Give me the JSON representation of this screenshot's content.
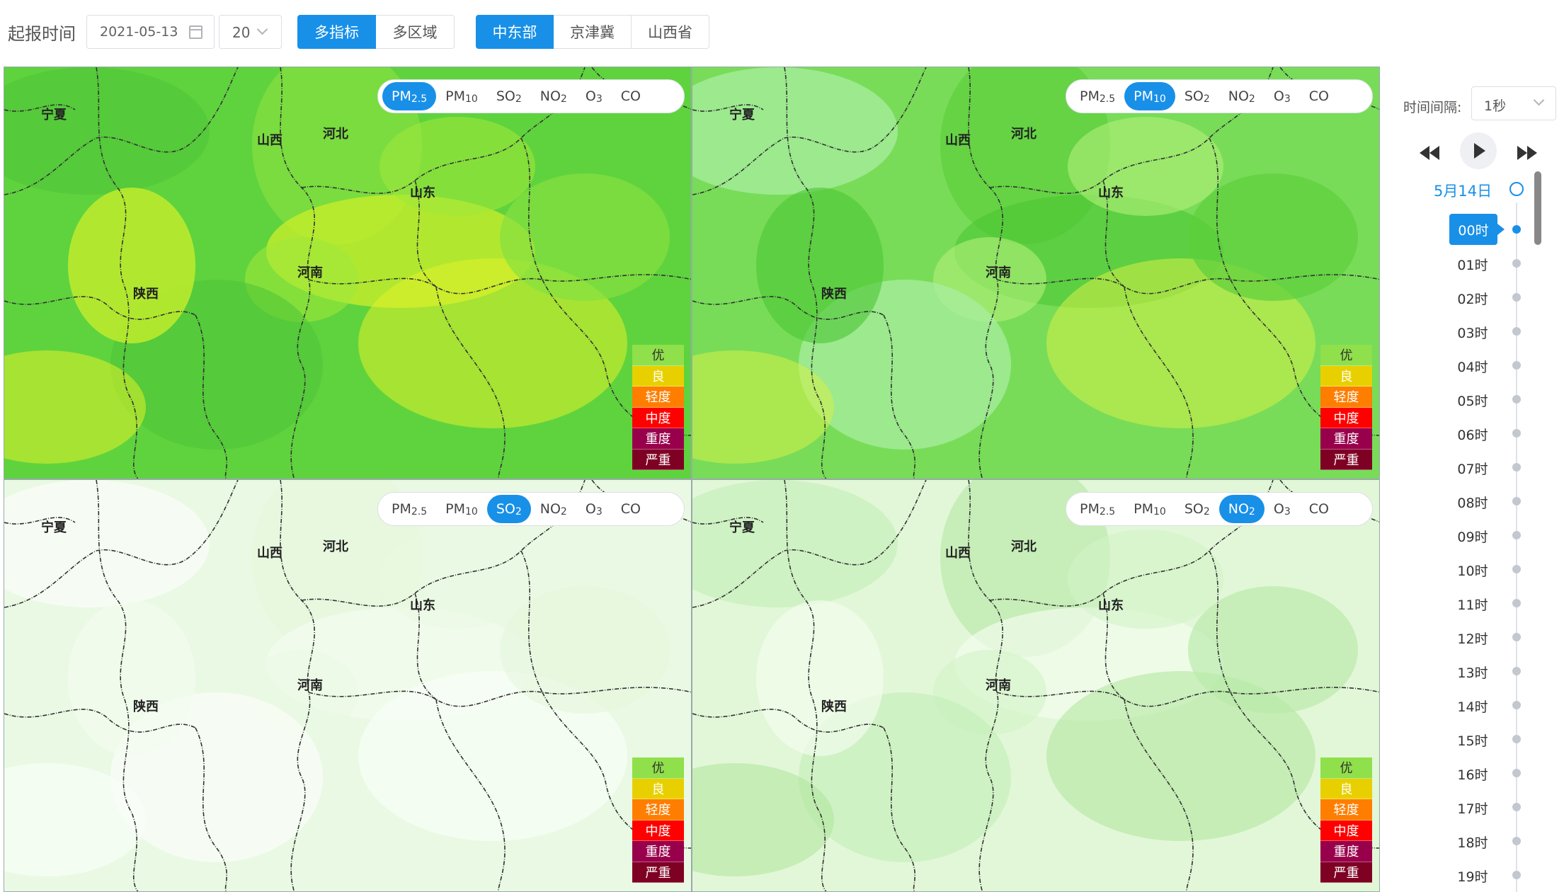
{
  "toolbar": {
    "label": "起报时间",
    "date_value": "2021-05-13",
    "hour_value": "20",
    "mode_tabs": [
      {
        "label": "多指标",
        "active": true
      },
      {
        "label": "多区域",
        "active": false
      }
    ],
    "region_tabs": [
      {
        "label": "中东部",
        "active": true
      },
      {
        "label": "京津冀",
        "active": false
      },
      {
        "label": "山西省",
        "active": false
      }
    ]
  },
  "pollutants": [
    {
      "base": "PM",
      "sub": "2.5"
    },
    {
      "base": "PM",
      "sub": "10"
    },
    {
      "base": "SO",
      "sub": "2"
    },
    {
      "base": "NO",
      "sub": "2"
    },
    {
      "base": "O",
      "sub": "3"
    },
    {
      "base": "CO",
      "sub": ""
    }
  ],
  "panels": [
    {
      "active_pollutant": 0,
      "theme": "pm25"
    },
    {
      "active_pollutant": 1,
      "theme": "pm10"
    },
    {
      "active_pollutant": 2,
      "theme": "so2"
    },
    {
      "active_pollutant": 3,
      "theme": "no2"
    }
  ],
  "places": [
    "宁夏",
    "山西",
    "河北",
    "山东",
    "河南",
    "陕西"
  ],
  "legend": [
    {
      "label": "优",
      "color": "#8fe04a"
    },
    {
      "label": "良",
      "color": "#e8d000"
    },
    {
      "label": "轻度",
      "color": "#ff7e00"
    },
    {
      "label": "中度",
      "color": "#ff0000"
    },
    {
      "label": "重度",
      "color": "#99004c"
    },
    {
      "label": "严重",
      "color": "#7e0023"
    }
  ],
  "timeline": {
    "interval_label": "时间间隔:",
    "interval_value": "1秒",
    "day": "5月14日",
    "hours": [
      "00时",
      "01时",
      "02时",
      "03时",
      "04时",
      "05时",
      "06时",
      "07时",
      "08时",
      "09时",
      "10时",
      "11时",
      "12时",
      "13时",
      "14时",
      "15时",
      "16时",
      "17时",
      "18时",
      "19时"
    ],
    "active_hour": 0
  }
}
